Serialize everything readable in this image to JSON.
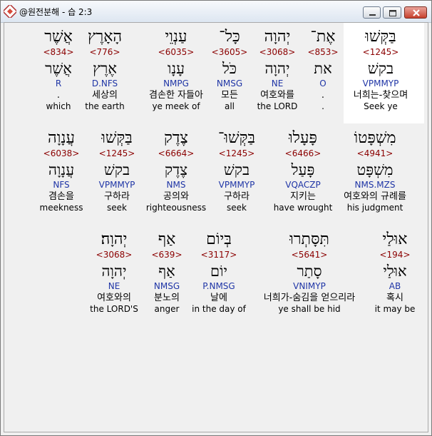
{
  "window": {
    "title": "@원전분해 - 습 2:3",
    "icon": "app-window-icon",
    "controls": [
      "minimize-icon",
      "maximize-icon",
      "close-icon"
    ]
  },
  "rows": [
    {
      "words": [
        {
          "heb": "בַּקְּשׁוּ",
          "strong": "<1245>",
          "lemma": "בקשׁ",
          "parse": "VPMMYP",
          "ko": "너희는-찾으며",
          "en": "Seek ye"
        },
        {
          "heb": "אֶת־",
          "strong": "<853>",
          "lemma": "את",
          "parse": "O",
          "ko": ".",
          "en": "."
        },
        {
          "heb": "יְהוָה",
          "strong": "<3068>",
          "lemma": "יְהוָה",
          "parse": "NE",
          "ko": "여호와를",
          "en": "the LORD"
        },
        {
          "heb": "כָּל־",
          "strong": "<3605>",
          "lemma": "כֹּל",
          "parse": "NMSG",
          "ko": "모든",
          "en": "all"
        },
        {
          "heb": "עַנְוֵי",
          "strong": "<6035>",
          "lemma": "עָנָו",
          "parse": "NMPG",
          "ko": "겸손한 자들아",
          "en": "ye meek of"
        },
        {
          "heb": "הָאָרֶץ",
          "strong": "<776>",
          "lemma": "אֶרֶץ",
          "parse": "D.NFS",
          "ko": "세상의",
          "en": "the earth"
        },
        {
          "heb": "אֲשֶׁר",
          "strong": "<834>",
          "lemma": "אֲשֶׁר",
          "parse": "R",
          "ko": ".",
          "en": "which"
        }
      ]
    },
    {
      "words": [
        {
          "heb": "מִשְׁפָּטוֹ",
          "strong": "<4941>",
          "lemma": "מִשְׁפָּט",
          "parse": "NMS.MZS",
          "ko": "여호와의 규례를",
          "en": "his judgment"
        },
        {
          "heb": "פָּעָלוּ",
          "strong": "<6466>",
          "lemma": "פָּעַל",
          "parse": "VQACZP",
          "ko": "지키는",
          "en": "have wrought"
        },
        {
          "heb": "בַּקְּשׁוּ־",
          "strong": "<1245>",
          "lemma": "בקשׁ",
          "parse": "VPMMYP",
          "ko": "구하라",
          "en": "seek"
        },
        {
          "heb": "צֶדֶק",
          "strong": "<6664>",
          "lemma": "צֶדֶק",
          "parse": "NMS",
          "ko": "공의와",
          "en": "righteousness"
        },
        {
          "heb": "בַּקְּשׁוּ",
          "strong": "<1245>",
          "lemma": "בקשׁ",
          "parse": "VPMMYP",
          "ko": "구하라",
          "en": "seek"
        },
        {
          "heb": "עֲנָוָה",
          "strong": "<6038>",
          "lemma": "עֲנָוָה",
          "parse": "NFS",
          "ko": "겸손을",
          "en": "meekness"
        }
      ]
    },
    {
      "words": [
        {
          "heb": "אוּלַי",
          "strong": "<194>",
          "lemma": "אוּלַי",
          "parse": "AB",
          "ko": "혹시",
          "en": "it may be"
        },
        {
          "heb": "תִּסָּתְרוּ",
          "strong": "<5641>",
          "lemma": "סָתַר",
          "parse": "VNIMYP",
          "ko": "너희가-숨김을 얻으리라",
          "en": "ye shall be hid"
        },
        {
          "heb": "בְּיוֹם",
          "strong": "<3117>",
          "lemma": "יוֹם",
          "parse": "P.NMSG",
          "ko": "날에",
          "en": "in the day of"
        },
        {
          "heb": "אַף",
          "strong": "<639>",
          "lemma": "אַף",
          "parse": "NMSG",
          "ko": "분노의",
          "en": "anger"
        },
        {
          "heb": "יְהוָה׃",
          "strong": "<3068>",
          "lemma": "יְהוָה",
          "parse": "NE",
          "ko": "여호와의",
          "en": "the LORD'S"
        }
      ]
    }
  ]
}
